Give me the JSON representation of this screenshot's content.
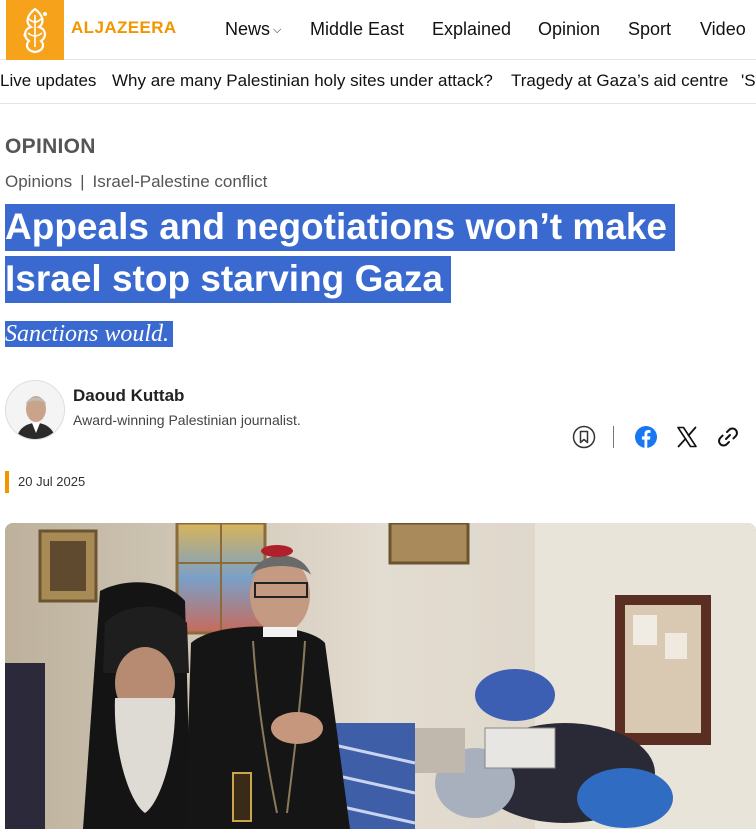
{
  "brand": {
    "logo_text": "ALJAZEERA",
    "accent": "#f29600"
  },
  "nav": {
    "items": [
      {
        "label": "News",
        "has_dropdown": true
      },
      {
        "label": "Middle East"
      },
      {
        "label": "Explained"
      },
      {
        "label": "Opinion"
      },
      {
        "label": "Sport"
      },
      {
        "label": "Video"
      }
    ]
  },
  "trending": {
    "items": [
      "Live updates",
      "Why are many Palestinian holy sites under attack?",
      "Tragedy at Gaza’s aid centre",
      "'St"
    ]
  },
  "article": {
    "kicker": "OPINION",
    "breadcrumb": [
      "Opinions",
      "Israel-Palestine conflict"
    ],
    "breadcrumb_separator": "|",
    "headline_line1": "Appeals and negotiations won’t make",
    "headline_line2": "Israel stop starving Gaza",
    "standfirst": "Sanctions would.",
    "selection_color": "#3a6ad0",
    "author": {
      "name": "Daoud Kuttab",
      "bio": "Award-winning Palestinian journalist."
    },
    "date": "20 Jul 2025"
  },
  "share": {
    "icons": [
      "bookmark-icon",
      "facebook-icon",
      "x-icon",
      "link-icon"
    ],
    "facebook_color": "#1877f2"
  }
}
